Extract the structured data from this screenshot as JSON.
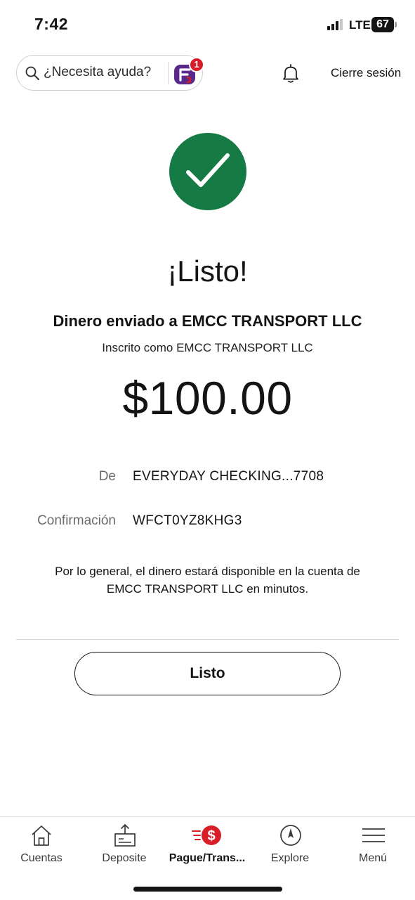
{
  "status_bar": {
    "time": "7:42",
    "network": "LTE",
    "battery": "67"
  },
  "top_bar": {
    "search_placeholder": "¿Necesita ayuda?",
    "notification_badge": "1",
    "logout_label": "Cierre sesión"
  },
  "confirmation": {
    "headline": "¡Listo!",
    "sent_to": "Dinero enviado a EMCC TRANSPORT LLC",
    "enrolled_as": "Inscrito como EMCC TRANSPORT LLC",
    "amount": "$100.00",
    "details": [
      {
        "label": "De",
        "value": "EVERYDAY CHECKING...7708"
      },
      {
        "label": "Confirmación",
        "value": "WFCT0YZ8KHG3"
      }
    ],
    "note": "Por lo general, el dinero estará disponible en la cuenta de EMCC TRANSPORT LLC en minutos.",
    "done_label": "Listo"
  },
  "bottom_nav": {
    "items": [
      {
        "label": "Cuentas",
        "icon": "home-icon"
      },
      {
        "label": "Deposite",
        "icon": "deposit-icon"
      },
      {
        "label": "Pague/Trans...",
        "icon": "pay-transfer-icon",
        "active": true
      },
      {
        "label": "Explore",
        "icon": "compass-icon"
      },
      {
        "label": "Menú",
        "icon": "menu-icon"
      }
    ]
  },
  "colors": {
    "success_green": "#167a45",
    "brand_red": "#d71e28",
    "brand_purple": "#5a2a8a",
    "text": "#141414",
    "muted": "#6b6b6b"
  }
}
